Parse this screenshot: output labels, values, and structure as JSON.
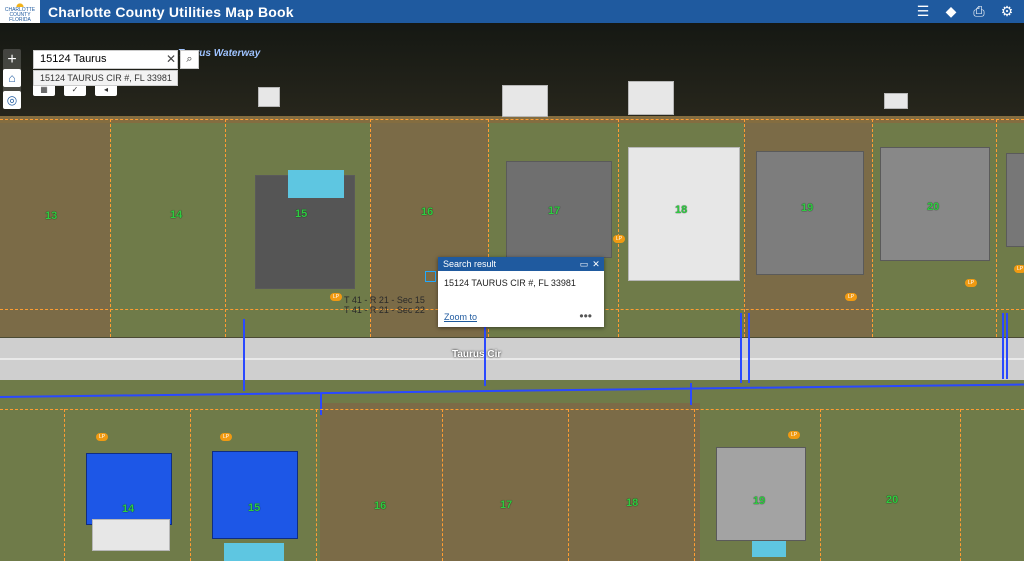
{
  "header": {
    "title": "Charlotte County Utilities Map Book",
    "logo_text": "CHARLOTTE COUNTY FLORIDA"
  },
  "header_icons": [
    "list-icon",
    "layers-icon",
    "print-icon",
    "share-icon"
  ],
  "search": {
    "value": "15124 Taurus",
    "suggestion": "15124 TAURUS CIR #, FL 33981"
  },
  "map": {
    "waterway_label": "Taurus Waterway",
    "road_label": "Taurus Cir",
    "section_labels": [
      "T 41 - R 21 - Sec 15",
      "T 41 - R 21 - Sec 22"
    ],
    "parcels_north": [
      "13",
      "14",
      "15",
      "16",
      "17",
      "18",
      "19",
      "20"
    ],
    "parcels_south": [
      "14",
      "15",
      "16",
      "17",
      "18",
      "19",
      "20"
    ],
    "lp_marker": "LP"
  },
  "popup": {
    "title": "Search result",
    "address": "15124 TAURUS CIR #, FL 33981",
    "zoom_link": "Zoom to",
    "menu": "•••"
  }
}
